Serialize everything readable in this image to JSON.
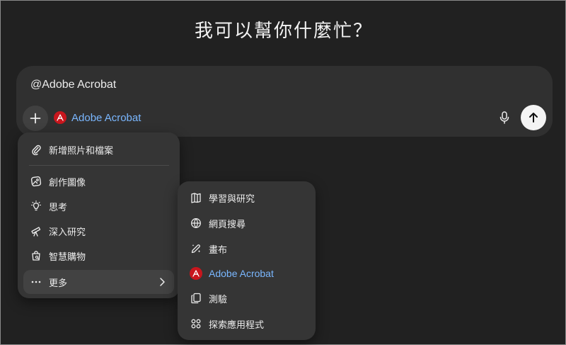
{
  "heading": "我可以幫你什麼忙？",
  "composer": {
    "text": "@Adobe Acrobat",
    "chip_label": "Adobe Acrobat"
  },
  "menu": {
    "items": [
      {
        "label": "新增照片和檔案",
        "icon": "paperclip-icon"
      },
      {
        "label": "創作圖像",
        "icon": "image-create-icon"
      },
      {
        "label": "思考",
        "icon": "lightbulb-icon"
      },
      {
        "label": "深入研究",
        "icon": "telescope-icon"
      },
      {
        "label": "智慧購物",
        "icon": "shopping-bag-icon"
      },
      {
        "label": "更多",
        "icon": "ellipsis-icon"
      }
    ]
  },
  "submenu": {
    "items": [
      {
        "label": "學習與研究",
        "icon": "book-icon"
      },
      {
        "label": "網頁搜尋",
        "icon": "globe-icon"
      },
      {
        "label": "畫布",
        "icon": "pen-icon"
      },
      {
        "label": "Adobe Acrobat",
        "icon": "acrobat-icon"
      },
      {
        "label": "測驗",
        "icon": "quiz-icon"
      },
      {
        "label": "探索應用程式",
        "icon": "apps-grid-icon"
      }
    ]
  },
  "colors": {
    "background": "#212121",
    "composer": "#303030",
    "menu": "#353535",
    "link_blue": "#7ab7ff",
    "acrobat_red": "#c8161d"
  }
}
